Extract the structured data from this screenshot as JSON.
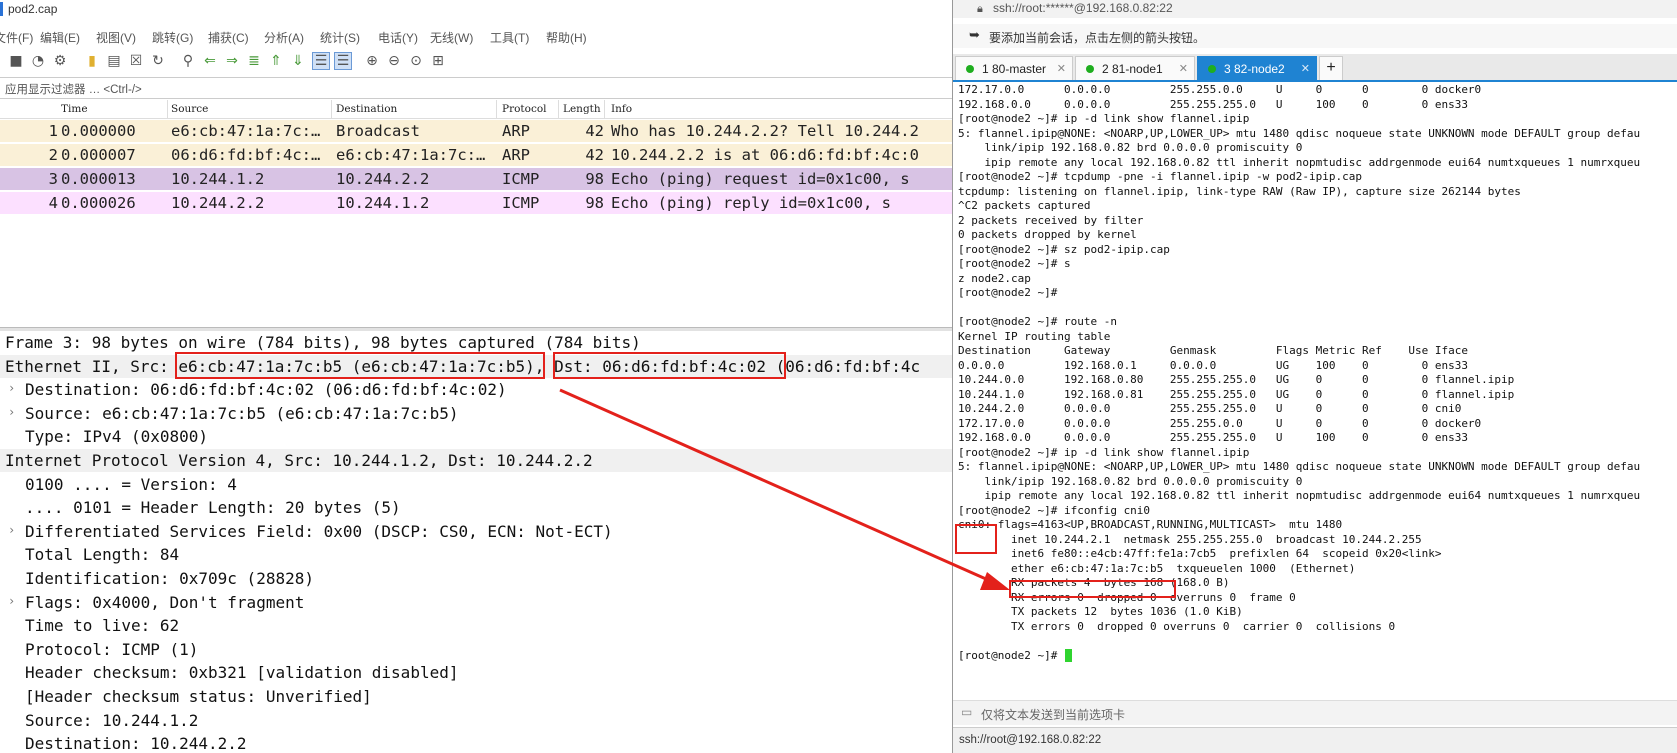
{
  "wireshark": {
    "title": "pod2.cap",
    "menu": [
      "文件(F)",
      "编辑(E)",
      "视图(V)",
      "跳转(G)",
      "捕获(C)",
      "分析(A)",
      "统计(S)",
      "电话(Y)",
      "无线(W)",
      "工具(T)",
      "帮助(H)"
    ],
    "filter_placeholder": "应用显示过滤器 … <Ctrl-/>",
    "columns": [
      "Time",
      "Source",
      "Destination",
      "Protocol",
      "Length",
      "Info"
    ],
    "packets": [
      {
        "no": "1",
        "time": "0.000000",
        "source": "e6:cb:47:1a:7c:…",
        "destination": "Broadcast",
        "protocol": "ARP",
        "length": "42",
        "info": "Who has 10.244.2.2? Tell 10.244.2",
        "color": "#faf0d7"
      },
      {
        "no": "2",
        "time": "0.000007",
        "source": "06:d6:fd:bf:4c:…",
        "destination": "e6:cb:47:1a:7c:…",
        "protocol": "ARP",
        "length": "42",
        "info": "10.244.2.2 is at 06:d6:fd:bf:4c:0",
        "color": "#faf0d7"
      },
      {
        "no": "3",
        "time": "0.000013",
        "source": "10.244.1.2",
        "destination": "10.244.2.2",
        "protocol": "ICMP",
        "length": "98",
        "info": "Echo (ping) request  id=0x1c00, s",
        "color": "#d8c3e4"
      },
      {
        "no": "4",
        "time": "0.000026",
        "source": "10.244.2.2",
        "destination": "10.244.1.2",
        "protocol": "ICMP",
        "length": "98",
        "info": "Echo (ping) reply    id=0x1c00, s",
        "color": "#fce0ff"
      }
    ],
    "details": [
      {
        "text": "Frame 3: 98 bytes on wire (784 bits), 98 bytes captured (784 bits)",
        "indent": 0,
        "arrow": "",
        "header": false
      },
      {
        "text": "Ethernet II, Src: e6:cb:47:1a:7c:b5 (e6:cb:47:1a:7c:b5), Dst: 06:d6:fd:bf:4c:02 (06:d6:fd:bf:4c",
        "indent": 0,
        "arrow": "",
        "header": true
      },
      {
        "text": "Destination: 06:d6:fd:bf:4c:02 (06:d6:fd:bf:4c:02)",
        "indent": 1,
        "arrow": "›",
        "header": false
      },
      {
        "text": "Source: e6:cb:47:1a:7c:b5 (e6:cb:47:1a:7c:b5)",
        "indent": 1,
        "arrow": "›",
        "header": false
      },
      {
        "text": "Type: IPv4 (0x0800)",
        "indent": 1,
        "arrow": "",
        "header": false
      },
      {
        "text": "Internet Protocol Version 4, Src: 10.244.1.2, Dst: 10.244.2.2",
        "indent": 0,
        "arrow": "",
        "header": true
      },
      {
        "text": "0100 .... = Version: 4",
        "indent": 1,
        "arrow": "",
        "header": false
      },
      {
        "text": ".... 0101 = Header Length: 20 bytes (5)",
        "indent": 1,
        "arrow": "",
        "header": false
      },
      {
        "text": "Differentiated Services Field: 0x00 (DSCP: CS0, ECN: Not-ECT)",
        "indent": 1,
        "arrow": "›",
        "header": false
      },
      {
        "text": "Total Length: 84",
        "indent": 1,
        "arrow": "",
        "header": false
      },
      {
        "text": "Identification: 0x709c (28828)",
        "indent": 1,
        "arrow": "",
        "header": false
      },
      {
        "text": "Flags: 0x4000, Don't fragment",
        "indent": 1,
        "arrow": "›",
        "header": false
      },
      {
        "text": "Time to live: 62",
        "indent": 1,
        "arrow": "",
        "header": false
      },
      {
        "text": "Protocol: ICMP (1)",
        "indent": 1,
        "arrow": "",
        "header": false
      },
      {
        "text": "Header checksum: 0xb321 [validation disabled]",
        "indent": 1,
        "arrow": "",
        "header": false
      },
      {
        "text": "[Header checksum status: Unverified]",
        "indent": 1,
        "arrow": "",
        "header": false
      },
      {
        "text": "Source: 10.244.1.2",
        "indent": 1,
        "arrow": "",
        "header": false
      },
      {
        "text": "Destination: 10.244.2.2",
        "indent": 1,
        "arrow": "",
        "header": false
      }
    ]
  },
  "xshell": {
    "address": "ssh://root:******@192.168.0.82:22",
    "hint": "要添加当前会话，点击左侧的箭头按钮。",
    "tabs": [
      {
        "label": "1 80-master",
        "active": false
      },
      {
        "label": "2 81-node1",
        "active": false
      },
      {
        "label": "3 82-node2",
        "active": true
      }
    ],
    "new_tab": "+",
    "terminal_lines": [
      "172.17.0.0      0.0.0.0         255.255.0.0     U     0      0        0 docker0",
      "192.168.0.0     0.0.0.0         255.255.255.0   U     100    0        0 ens33",
      "[root@node2 ~]# ip -d link show flannel.ipip",
      "5: flannel.ipip@NONE: <NOARP,UP,LOWER_UP> mtu 1480 qdisc noqueue state UNKNOWN mode DEFAULT group defau",
      "    link/ipip 192.168.0.82 brd 0.0.0.0 promiscuity 0",
      "    ipip remote any local 192.168.0.82 ttl inherit nopmtudisc addrgenmode eui64 numtxqueues 1 numrxqueu",
      "[root@node2 ~]# tcpdump -pne -i flannel.ipip -w pod2-ipip.cap",
      "tcpdump: listening on flannel.ipip, link-type RAW (Raw IP), capture size 262144 bytes",
      "^C2 packets captured",
      "2 packets received by filter",
      "0 packets dropped by kernel",
      "[root@node2 ~]# sz pod2-ipip.cap",
      "[root@node2 ~]# s",
      "z node2.cap",
      "[root@node2 ~]#",
      "",
      "[root@node2 ~]# route -n",
      "Kernel IP routing table",
      "Destination     Gateway         Genmask         Flags Metric Ref    Use Iface",
      "0.0.0.0         192.168.0.1     0.0.0.0         UG    100    0        0 ens33",
      "10.244.0.0      192.168.0.80    255.255.255.0   UG    0      0        0 flannel.ipip",
      "10.244.1.0      192.168.0.81    255.255.255.0   UG    0      0        0 flannel.ipip",
      "10.244.2.0      0.0.0.0         255.255.255.0   U     0      0        0 cni0",
      "172.17.0.0      0.0.0.0         255.255.0.0     U     0      0        0 docker0",
      "192.168.0.0     0.0.0.0         255.255.255.0   U     100    0        0 ens33",
      "[root@node2 ~]# ip -d link show flannel.ipip",
      "5: flannel.ipip@NONE: <NOARP,UP,LOWER_UP> mtu 1480 qdisc noqueue state UNKNOWN mode DEFAULT group defau",
      "    link/ipip 192.168.0.82 brd 0.0.0.0 promiscuity 0",
      "    ipip remote any local 192.168.0.82 ttl inherit nopmtudisc addrgenmode eui64 numtxqueues 1 numrxqueu",
      "[root@node2 ~]# ifconfig cni0",
      "cni0: flags=4163<UP,BROADCAST,RUNNING,MULTICAST>  mtu 1480",
      "        inet 10.244.2.1  netmask 255.255.255.0  broadcast 10.244.2.255",
      "        inet6 fe80::e4cb:47ff:fe1a:7cb5  prefixlen 64  scopeid 0x20<link>",
      "        ether e6:cb:47:1a:7c:b5  txqueuelen 1000  (Ethernet)",
      "        RX packets 4  bytes 168 (168.0 B)",
      "        RX errors 0  dropped 0  overruns 0  frame 0",
      "        TX packets 12  bytes 1036 (1.0 KiB)",
      "        TX errors 0  dropped 0 overruns 0  carrier 0  collisions 0",
      "",
      "[root@node2 ~]# "
    ],
    "send_bar": "仅将文本发送到当前选项卡",
    "status": "ssh://root@192.168.0.82:22"
  },
  "annotation_color": "#e3211b"
}
